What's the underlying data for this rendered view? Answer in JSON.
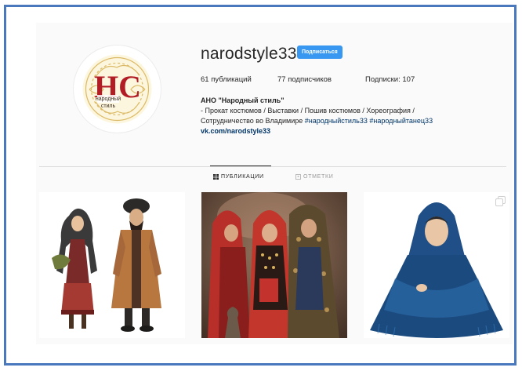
{
  "profile": {
    "username": "narodstyle33",
    "follow_label": "Подписаться",
    "avatar_text_main": "НС",
    "avatar_text_sub1": "народный",
    "avatar_text_sub2": "стиль"
  },
  "stats": {
    "posts": "61 публикаций",
    "followers": "77 подписчиков",
    "following": "Подписки: 107"
  },
  "bio": {
    "name": "АНО \"Народный стиль\"",
    "line1": "- Прокат костюмов / Выставки / Пошив костюмов / Хореография /",
    "line2_prefix": "Сотрудничество во Владимире ",
    "tag1": "#народныйстиль33",
    "tag2": "#народныйтанец33",
    "link": "vk.com/narodstyle33"
  },
  "tabs": [
    {
      "label": "ПУБЛИКАЦИИ",
      "active": true
    },
    {
      "label": "ОТМЕТКИ",
      "active": false
    }
  ],
  "colors": {
    "frame_border": "#4a78bd",
    "follow_button": "#3897f0",
    "link": "#003569"
  },
  "posts": [
    {
      "icon": "none"
    },
    {
      "icon": "none"
    },
    {
      "icon": "multiple-photos-icon"
    }
  ]
}
